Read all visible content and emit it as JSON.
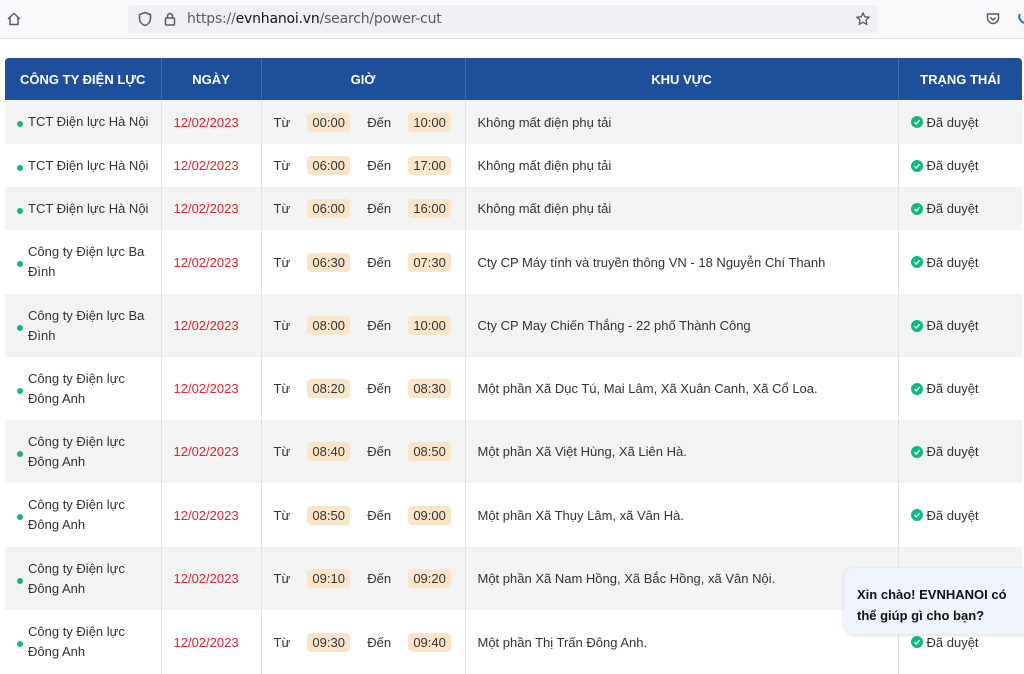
{
  "browser": {
    "url_host": "evnhanoi.vn",
    "url_path": "/search/power-cut",
    "url_scheme": "https://"
  },
  "table": {
    "headers": [
      "CÔNG TY ĐIỆN LỰC",
      "NGÀY",
      "GIỜ",
      "KHU VỰC",
      "TRẠNG THÁI"
    ],
    "from_label": "Từ",
    "to_label": "Đến",
    "rows": [
      {
        "company": "TCT Điện lực Hà Nội",
        "date": "12/02/2023",
        "from": "00:00",
        "to": "10:00",
        "area": "Không mất điện phụ tải",
        "status": "Đã duyệt"
      },
      {
        "company": "TCT Điện lực Hà Nội",
        "date": "12/02/2023",
        "from": "06:00",
        "to": "17:00",
        "area": "Không mất điện phụ tải",
        "status": "Đã duyệt"
      },
      {
        "company": "TCT Điện lực Hà Nội",
        "date": "12/02/2023",
        "from": "06:00",
        "to": "16:00",
        "area": "Không mất điện phụ tải",
        "status": "Đã duyệt"
      },
      {
        "company": "Công ty Điện lực Ba Đình",
        "date": "12/02/2023",
        "from": "06:30",
        "to": "07:30",
        "area": "Cty CP Máy tính và truyền thông VN - 18 Nguyễn Chí Thanh",
        "status": "Đã duyệt"
      },
      {
        "company": "Công ty Điện lực Ba Đình",
        "date": "12/02/2023",
        "from": "08:00",
        "to": "10:00",
        "area": "Cty CP May Chiến Thắng - 22 phố Thành Công",
        "status": "Đã duyệt"
      },
      {
        "company": "Công ty Điện lực Đông Anh",
        "date": "12/02/2023",
        "from": "08:20",
        "to": "08:30",
        "area": "Một phần Xã Dục Tú, Mai Lâm, Xã Xuân Canh, Xã Cổ Loa.",
        "status": "Đã duyệt"
      },
      {
        "company": "Công ty Điện lực Đông Anh",
        "date": "12/02/2023",
        "from": "08:40",
        "to": "08:50",
        "area": "Một phần Xã Việt Hùng, Xã Liên Hà.",
        "status": "Đã duyệt"
      },
      {
        "company": "Công ty Điện lực Đông Anh",
        "date": "12/02/2023",
        "from": "08:50",
        "to": "09:00",
        "area": "Một phần Xã Thụy Lâm, xã Vân Hà.",
        "status": "Đã duyệt"
      },
      {
        "company": "Công ty Điện lực Đông Anh",
        "date": "12/02/2023",
        "from": "09:10",
        "to": "09:20",
        "area": "Một phần Xã Nam Hồng, Xã Bắc Hồng, xã Vân Nội.",
        "status": "Đã duyệt"
      },
      {
        "company": "Công ty Điện lực Đông Anh",
        "date": "12/02/2023",
        "from": "09:30",
        "to": "09:40",
        "area": "Một phần Thị Trấn Đông Anh.",
        "status": "Đã duyệt"
      }
    ]
  },
  "chat": {
    "message": "Xin chào! EVNHANOI có thể giúp gì cho bạn?"
  },
  "colors": {
    "header_bg": "#1d4f9a",
    "date_red": "#e0252e",
    "status_green": "#10b981",
    "time_pill": "#fbe5c8"
  }
}
